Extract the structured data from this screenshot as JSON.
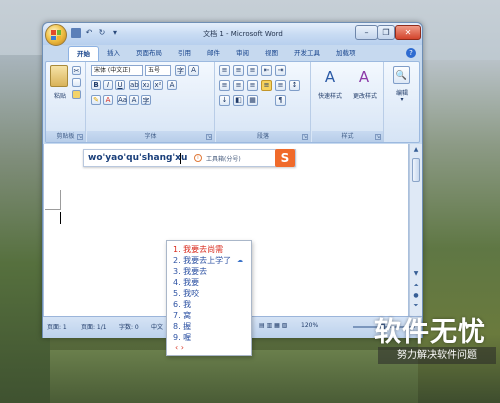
{
  "window": {
    "title": "文档 1 - Microsoft Word",
    "minimize": "–",
    "restore": "❐",
    "close": "✕"
  },
  "tabs": [
    {
      "label": "开始"
    },
    {
      "label": "插入"
    },
    {
      "label": "页面布局"
    },
    {
      "label": "引用"
    },
    {
      "label": "邮件"
    },
    {
      "label": "审阅"
    },
    {
      "label": "视图"
    },
    {
      "label": "开发工具"
    },
    {
      "label": "加载项"
    }
  ],
  "ribbon": {
    "clipboard": {
      "paste_label": "粘贴",
      "group_label": "剪贴板"
    },
    "font": {
      "font_name": "宋体 (中文正)",
      "font_size": "五号",
      "group_label": "字体"
    },
    "paragraph": {
      "group_label": "段落"
    },
    "styles": {
      "quick_styles": "快速样式",
      "change_styles": "更改样式",
      "group_label": "样式"
    },
    "editing": {
      "label": "编辑"
    }
  },
  "ime": {
    "pinyin": "wo'yao'qu'shang'xu",
    "hint": "工具箱(分号)",
    "logo": "S",
    "candidates": [
      {
        "text": "1. 我要去尚需"
      },
      {
        "text": "2. 我要去上学了"
      },
      {
        "text": "3. 我要去"
      },
      {
        "text": "4. 我要"
      },
      {
        "text": "5. 我咬"
      },
      {
        "text": "6. 我"
      },
      {
        "text": "7. 窝"
      },
      {
        "text": "8. 握"
      },
      {
        "text": "9. 喔"
      }
    ],
    "pager": "‹ ›"
  },
  "statusbar": {
    "page": "页面: 1",
    "pages": "页面: 1/1",
    "words": "字数: 0",
    "lang": "中文",
    "zoom": "120%"
  },
  "watermark": {
    "title": "软件无忧",
    "subtitle": "努力解决软件问题"
  },
  "colors": {
    "accent": "#15428b",
    "selected_candidate": "#d82a1d",
    "candidate": "#2d52a3",
    "sogou": "#f06a2a"
  }
}
